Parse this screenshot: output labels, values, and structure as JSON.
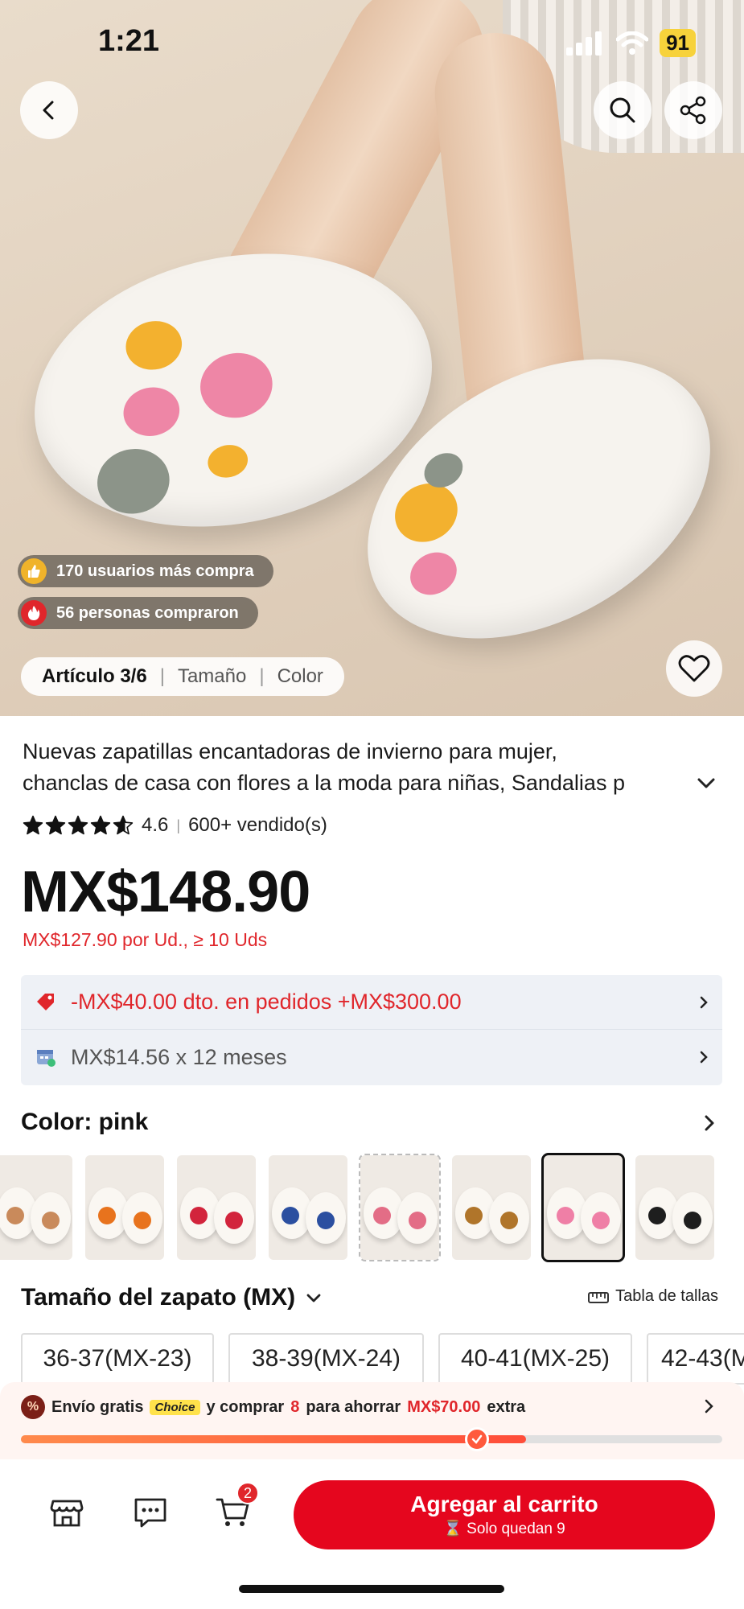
{
  "status_bar": {
    "time": "1:21",
    "battery": "91"
  },
  "hero": {
    "badges": [
      {
        "text": "170 usuarios más compra",
        "icon": "thumbs-up-icon",
        "color": "#f0b32a"
      },
      {
        "text": "56 personas compraron",
        "icon": "fire-icon",
        "color": "#e0262b"
      }
    ],
    "article_pill": {
      "article": "Artículo 3/6",
      "size": "Tamaño",
      "color": "Color"
    }
  },
  "product": {
    "title_line1": "Nuevas zapatillas encantadoras de invierno para mujer,",
    "title_line2": "chanclas de casa con flores a la moda para niñas, Sandalias p",
    "rating": "4.6",
    "rating_value": 4.6,
    "sold": "600+ vendido(s)",
    "price": "MX$148.90",
    "bulk_price": "MX$127.90 por Ud., ≥ 10 Uds"
  },
  "promos": {
    "discount": "-MX$40.00 dto. en pedidos +MX$300.00",
    "installments": "MX$14.56 x 12 meses"
  },
  "color_section": {
    "label": "Color: pink",
    "thumbnails": [
      {
        "name": "gingerbread",
        "accent": "#c98a5b"
      },
      {
        "name": "pumpkin",
        "accent": "#e8731d"
      },
      {
        "name": "rose-heart",
        "accent": "#d2243c"
      },
      {
        "name": "evil-eye",
        "accent": "#2b4fa0"
      },
      {
        "name": "hearts-love",
        "accent": "#e36d86"
      },
      {
        "name": "brown-mouse",
        "accent": "#b0752a"
      },
      {
        "name": "pink-mouse",
        "accent": "#ef7fa6"
      },
      {
        "name": "black-mouse",
        "accent": "#1e1e1e"
      }
    ],
    "selected_index": 6
  },
  "size_section": {
    "label": "Tamaño del zapato (MX)",
    "size_chart": "Tabla de tallas",
    "sizes": [
      "36-37(MX-23)",
      "38-39(MX-24)",
      "40-41(MX-25)",
      "42-43(MX-26)"
    ]
  },
  "shipping": {
    "part1": "Envío gratis",
    "choice": "Choice",
    "part2": "y comprar",
    "count": "8",
    "part3": "para ahorrar",
    "amount": "MX$70.00",
    "part4": "extra",
    "progress": 0.72
  },
  "bottom_bar": {
    "cart_count": "2",
    "add_to_cart": "Agregar al carrito",
    "stock_note": "⌛ Solo quedan 9"
  }
}
